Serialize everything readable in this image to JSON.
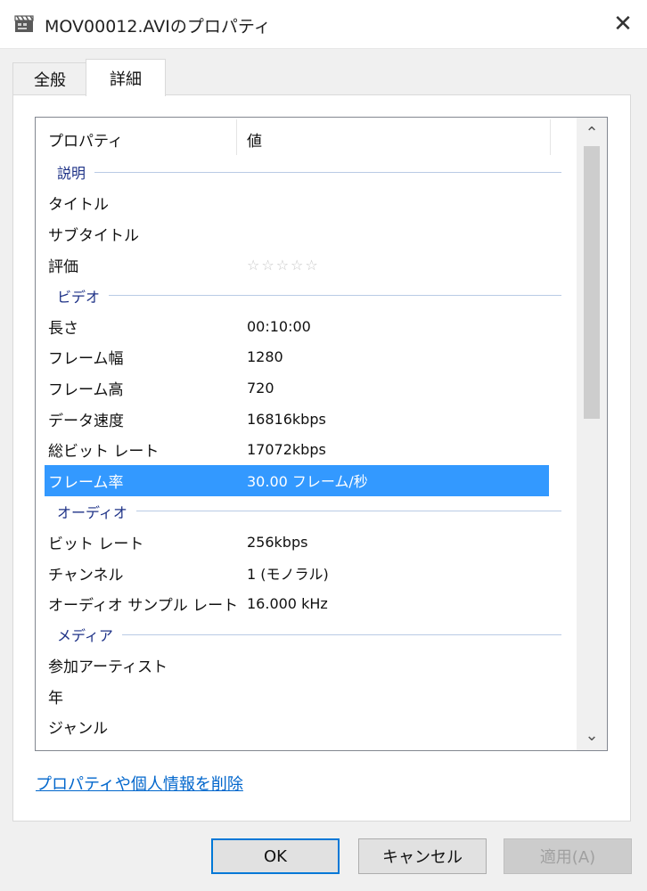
{
  "window": {
    "title": "MOV00012.AVIのプロパティ",
    "close_glyph": "✕"
  },
  "tabs": [
    {
      "label": "全般",
      "active": false
    },
    {
      "label": "詳細",
      "active": true
    }
  ],
  "list": {
    "header": {
      "property": "プロパティ",
      "value": "値"
    },
    "rows": [
      {
        "type": "group",
        "name": "説明"
      },
      {
        "type": "item",
        "name": "タイトル",
        "value": ""
      },
      {
        "type": "item",
        "name": "サブタイトル",
        "value": ""
      },
      {
        "type": "item",
        "name": "評価",
        "value": "☆☆☆☆☆",
        "rating": 0
      },
      {
        "type": "group",
        "name": "ビデオ"
      },
      {
        "type": "item",
        "name": "長さ",
        "value": "00:10:00"
      },
      {
        "type": "item",
        "name": "フレーム幅",
        "value": "1280"
      },
      {
        "type": "item",
        "name": "フレーム高",
        "value": "720"
      },
      {
        "type": "item",
        "name": "データ速度",
        "value": "16816kbps"
      },
      {
        "type": "item",
        "name": "総ビット レート",
        "value": "17072kbps"
      },
      {
        "type": "item",
        "name": "フレーム率",
        "value": "30.00 フレーム/秒",
        "selected": true
      },
      {
        "type": "group",
        "name": "オーディオ"
      },
      {
        "type": "item",
        "name": "ビット レート",
        "value": "256kbps"
      },
      {
        "type": "item",
        "name": "チャンネル",
        "value": "1 (モノラル)"
      },
      {
        "type": "item",
        "name": "オーディオ サンプル レート",
        "value": "16.000 kHz"
      },
      {
        "type": "group",
        "name": "メディア"
      },
      {
        "type": "item",
        "name": "参加アーティスト",
        "value": ""
      },
      {
        "type": "item",
        "name": "年",
        "value": ""
      },
      {
        "type": "item",
        "name": "ジャンル",
        "value": ""
      }
    ]
  },
  "scrollbar": {
    "up_glyph": "⌃",
    "down_glyph": "⌄"
  },
  "remove_link": "プロパティや個人情報を削除",
  "buttons": {
    "ok": "OK",
    "cancel": "キャンセル",
    "apply": "適用(A)"
  },
  "colors": {
    "selection": "#3399ff",
    "link": "#0066cc",
    "group_text": "#1e3287",
    "ok_border": "#0078d7"
  }
}
